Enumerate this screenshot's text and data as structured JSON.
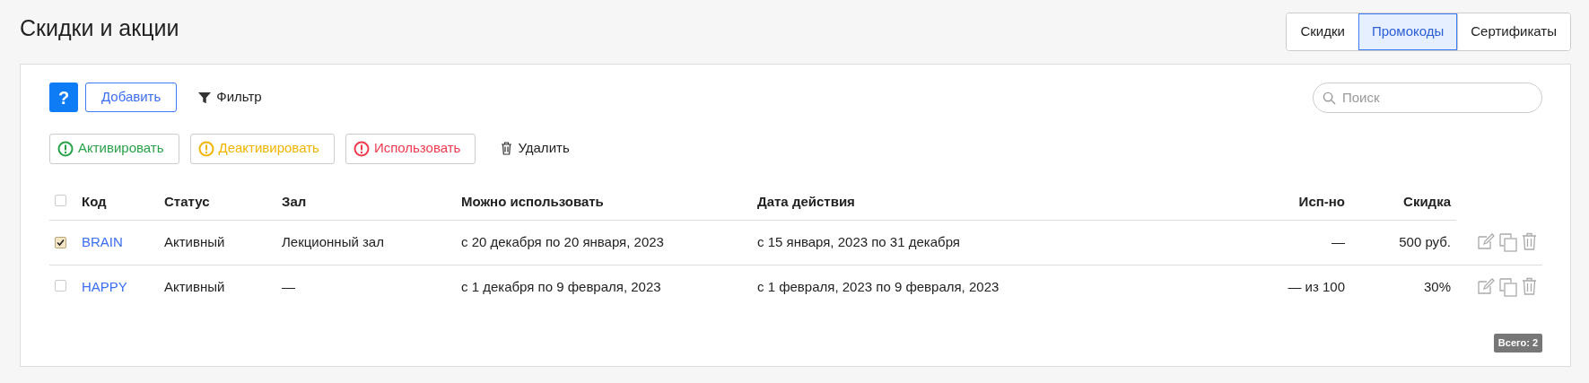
{
  "title": "Скидки и акции",
  "tabs": [
    {
      "label": "Скидки",
      "selected": false
    },
    {
      "label": "Промокоды",
      "selected": true
    },
    {
      "label": "Сертификаты",
      "selected": false
    }
  ],
  "toolbar": {
    "help": "?",
    "add": "Добавить",
    "filter": "Фильтр",
    "search": {
      "placeholder": "Поиск"
    }
  },
  "actions": [
    {
      "label": "Активировать",
      "kind": "success"
    },
    {
      "label": "Деактивировать",
      "kind": "warning"
    },
    {
      "label": "Использовать",
      "kind": "danger"
    },
    {
      "label": "Удалить",
      "kind": "delete"
    }
  ],
  "table": {
    "select_all": {
      "checked": false
    },
    "columns": [
      "Код",
      "Статус",
      "Зал",
      "Можно использовать",
      "Дата действия",
      "Исп-но",
      "Скидка"
    ],
    "rows": [
      {
        "selected": true,
        "cells": [
          "BRAIN",
          "Активный",
          "Лекционный зал",
          "с 20 декабря по 20 января, 2023",
          "с 15 января, 2023 по 31 декабря",
          "—",
          "500 руб."
        ]
      },
      {
        "selected": false,
        "cells": [
          "HAPPY",
          "Активный",
          "—",
          "с 1 декабря по 9 февраля, 2023",
          "с 1 февраля, 2023 по 9 февраля, 2023",
          "— из 100",
          "30%"
        ]
      }
    ]
  },
  "total": "Всего: 2"
}
